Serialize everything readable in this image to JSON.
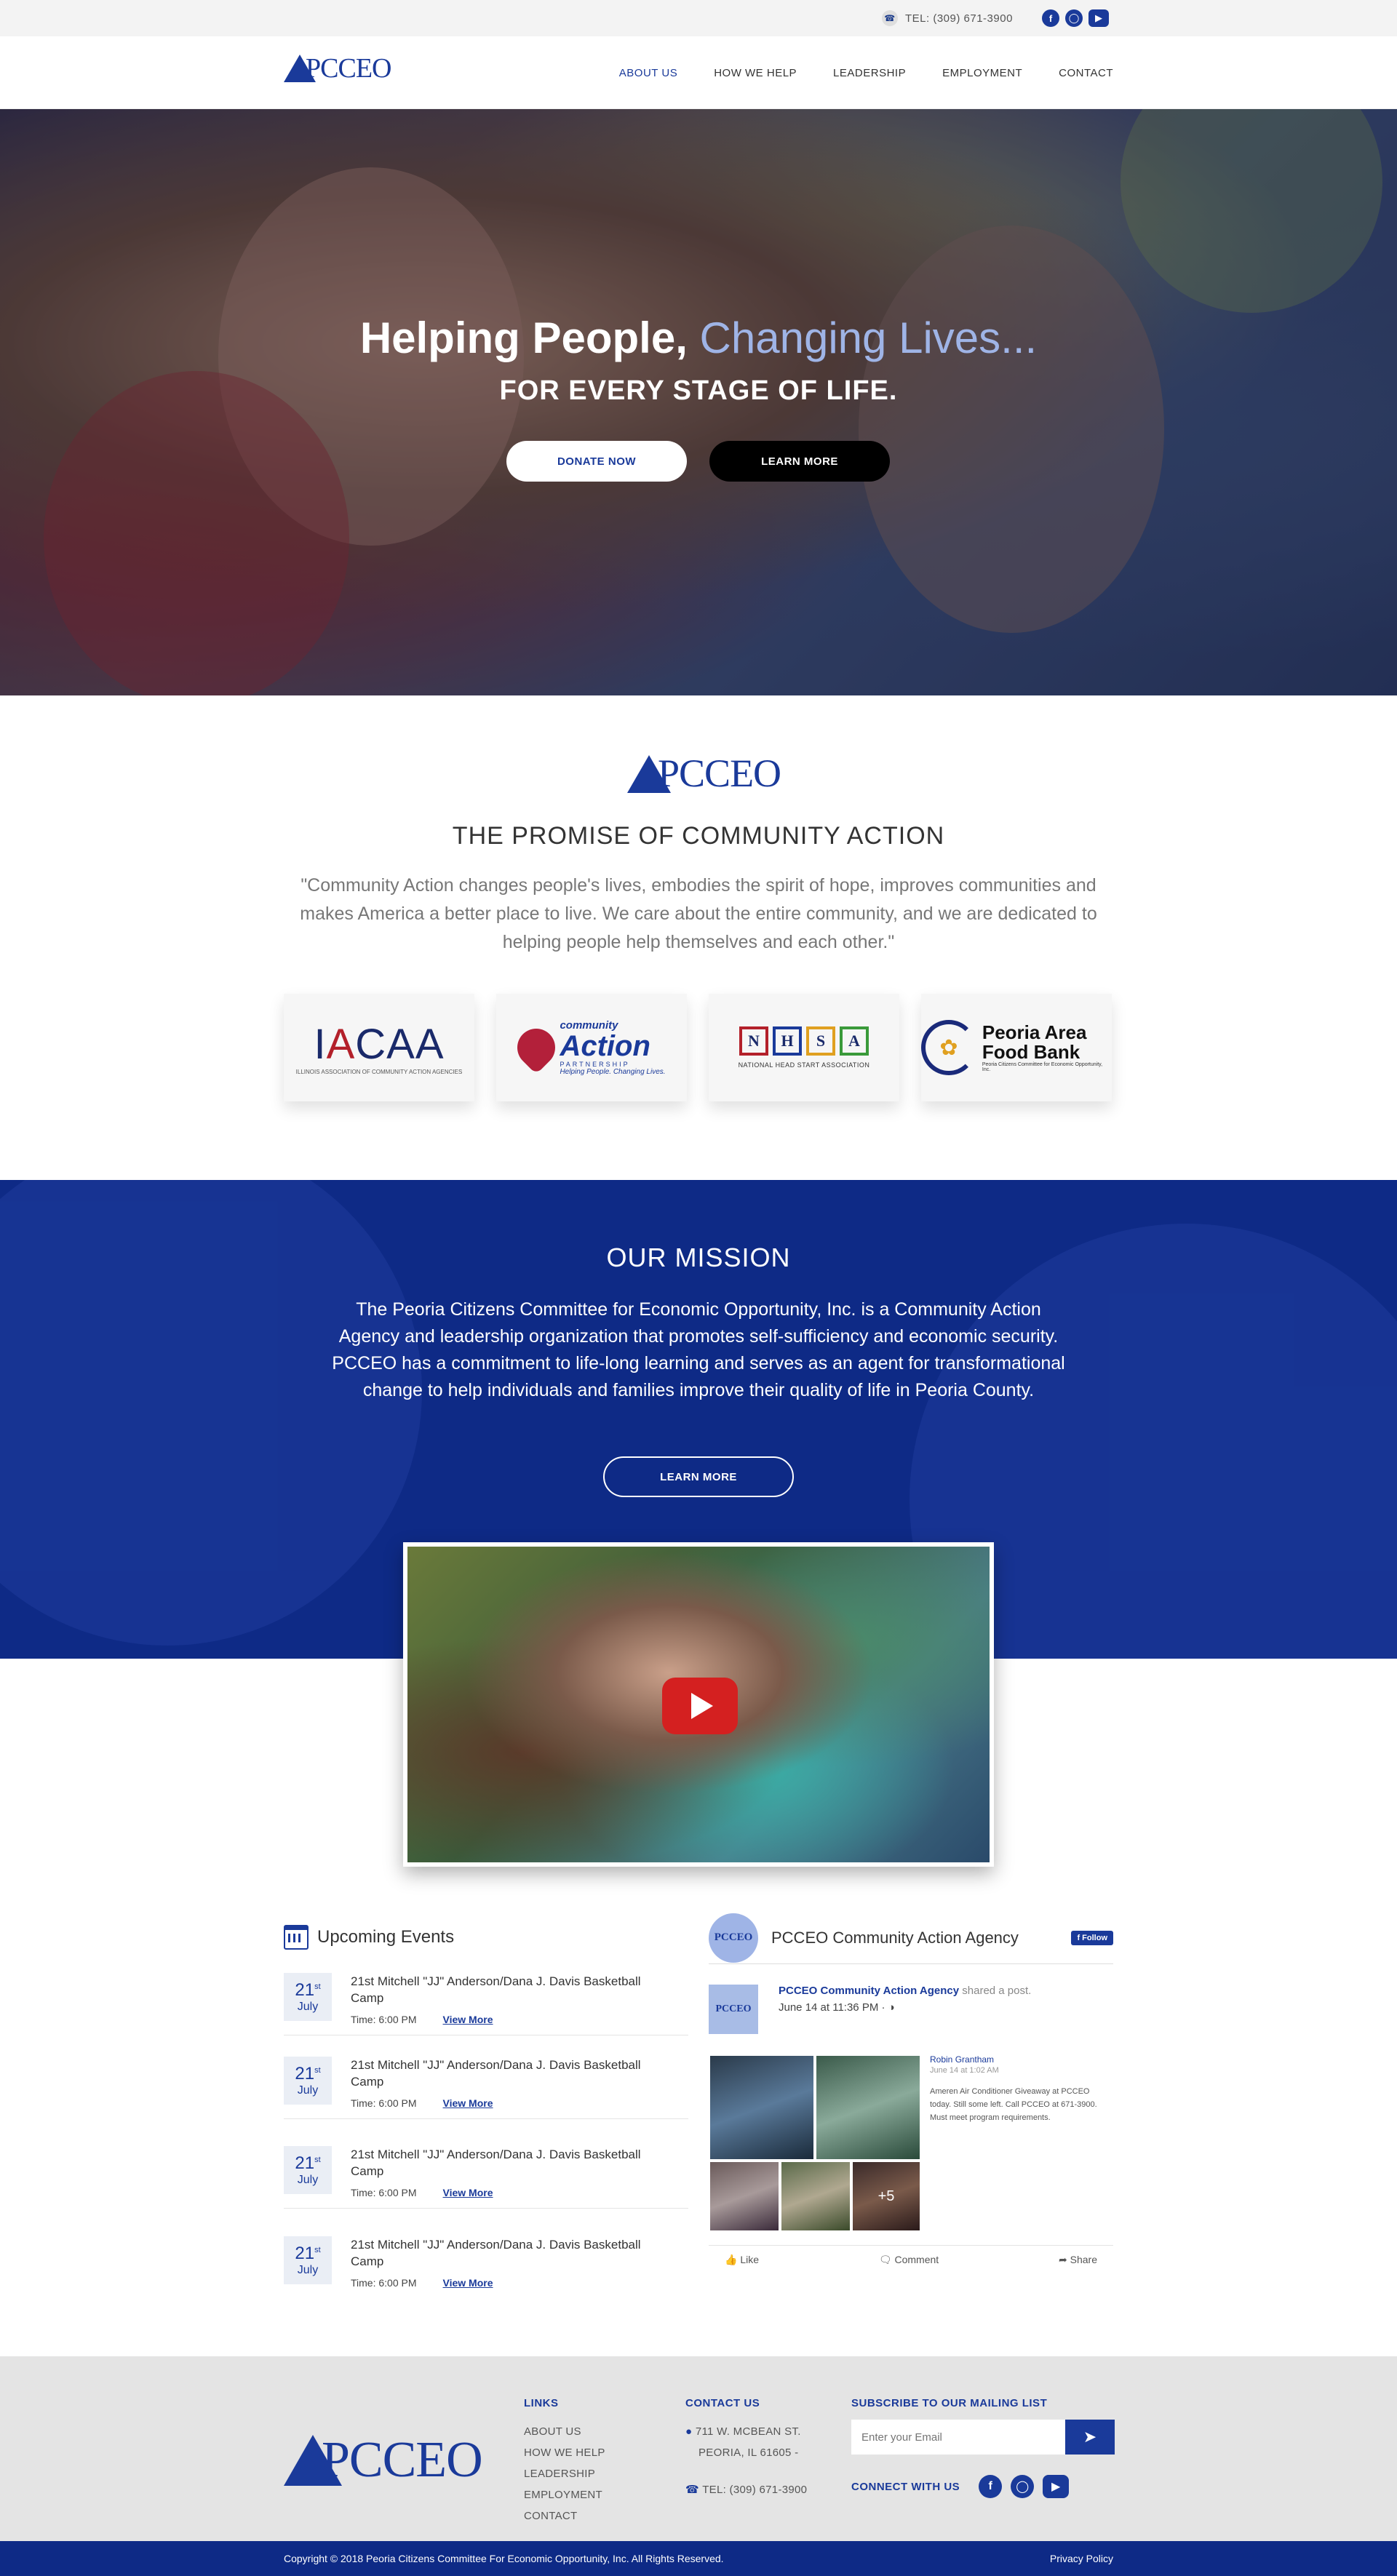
{
  "topbar": {
    "phone": "TEL: (309) 671-3900",
    "socials": [
      "facebook-icon",
      "instagram-icon",
      "youtube-icon"
    ]
  },
  "header": {
    "logo": "PCCEO",
    "nav": [
      {
        "label": "ABOUT US",
        "active": true
      },
      {
        "label": "HOW WE HELP",
        "active": false
      },
      {
        "label": "LEADERSHIP",
        "active": false
      },
      {
        "label": "EMPLOYMENT",
        "active": false
      },
      {
        "label": "CONTACT",
        "active": false
      }
    ]
  },
  "hero": {
    "title_main": "Helping People,",
    "title_accent": " Changing Lives...",
    "subtitle": "FOR EVERY STAGE OF LIFE.",
    "donate_label": "DONATE NOW",
    "learn_label": "LEARN MORE"
  },
  "promise": {
    "logo": "PCCEO",
    "title": "THE PROMISE OF COMMUNITY ACTION",
    "quote": "\"Community Action changes people's lives, embodies the spirit of hope, improves communities and makes America a better place to live. We care about the entire community, and we are dedicated to helping people help themselves and each other.\"",
    "partners": {
      "iacaa": {
        "name_pre": "I",
        "name_accent": "A",
        "name_post": "CAA",
        "tagline": "ILLINOIS ASSOCIATION OF COMMUNITY ACTION AGENCIES"
      },
      "cap": {
        "line1": "community",
        "line2": "Action",
        "line3": "PARTNERSHIP",
        "line4": "Helping People. Changing Lives."
      },
      "nhsa": {
        "letters": [
          "N",
          "H",
          "S",
          "A"
        ],
        "colors": [
          "#b3202a",
          "#1a3a9a",
          "#e0a020",
          "#3a9a3a"
        ],
        "tagline": "NATIONAL HEAD START ASSOCIATION"
      },
      "food": {
        "line1": "Peoria Area",
        "line2": "Food Bank",
        "line3": "Peoria Citizens Committee for Economic Opportunity, Inc."
      }
    }
  },
  "mission": {
    "title": "OUR MISSION",
    "text": "The Peoria Citizens Committee for Economic Opportunity, Inc. is a Community Action Agency and leadership organization that promotes self-sufficiency and economic security. PCCEO has a commitment to life-long learning and serves as an agent for transformational change to help individuals and families improve their quality of life in Peoria County.",
    "button": "LEARN MORE"
  },
  "events": {
    "heading": "Upcoming Events",
    "items": [
      {
        "day": "21",
        "suffix": "st",
        "month": "July",
        "title": "21st Mitchell \"JJ\" Anderson/Dana J. Davis Basketball Camp",
        "time": "Time: 6:00 PM",
        "link": "View More"
      },
      {
        "day": "21",
        "suffix": "st",
        "month": "July",
        "title": "21st Mitchell \"JJ\" Anderson/Dana J. Davis Basketball Camp",
        "time": "Time: 6:00 PM",
        "link": "View More"
      },
      {
        "day": "21",
        "suffix": "st",
        "month": "July",
        "title": "21st Mitchell \"JJ\" Anderson/Dana J. Davis Basketball Camp",
        "time": "Time: 6:00 PM",
        "link": "View More"
      },
      {
        "day": "21",
        "suffix": "st",
        "month": "July",
        "title": "21st Mitchell \"JJ\" Anderson/Dana J. Davis Basketball Camp",
        "time": "Time: 6:00 PM",
        "link": "View More"
      }
    ]
  },
  "facebook": {
    "page_name": "PCCEO Community Action Agency",
    "avatar_text": "PCCEO",
    "follow_label": "Follow",
    "post_author": "PCCEO Community Action Agency",
    "post_action": " shared a post.",
    "post_time": "June 14 at 11:36 PM · ",
    "shared_name": "Robin Grantham",
    "shared_time": "June 14 at 1:02 AM",
    "shared_text": "Ameren Air Conditioner Giveaway at PCCEO today. Still some left. Call PCCEO at 671-3900. Must meet program requirements.",
    "more_photos": "+5",
    "actions": [
      "Like",
      "Comment",
      "Share"
    ]
  },
  "footer": {
    "logo": "PCCEO",
    "links_heading": "LINKS",
    "links": [
      "ABOUT US",
      "HOW WE HELP",
      "LEADERSHIP",
      "EMPLOYMENT",
      "CONTACT"
    ],
    "contact_heading": "CONTACT US",
    "address_line1": "711 W. MCBEAN ST.",
    "address_line2": "PEORIA, IL 61605 -",
    "phone": "TEL: (309) 671-3900",
    "subscribe_heading": "SUBSCRIBE TO OUR MAILING LIST",
    "email_placeholder": "Enter your Email",
    "connect_label": "CONNECT WITH US",
    "copyright": "Copyright © 2018 Peoria Citizens Committee For Economic Opportunity, Inc. All Rights Reserved.",
    "privacy": "Privacy Policy"
  }
}
